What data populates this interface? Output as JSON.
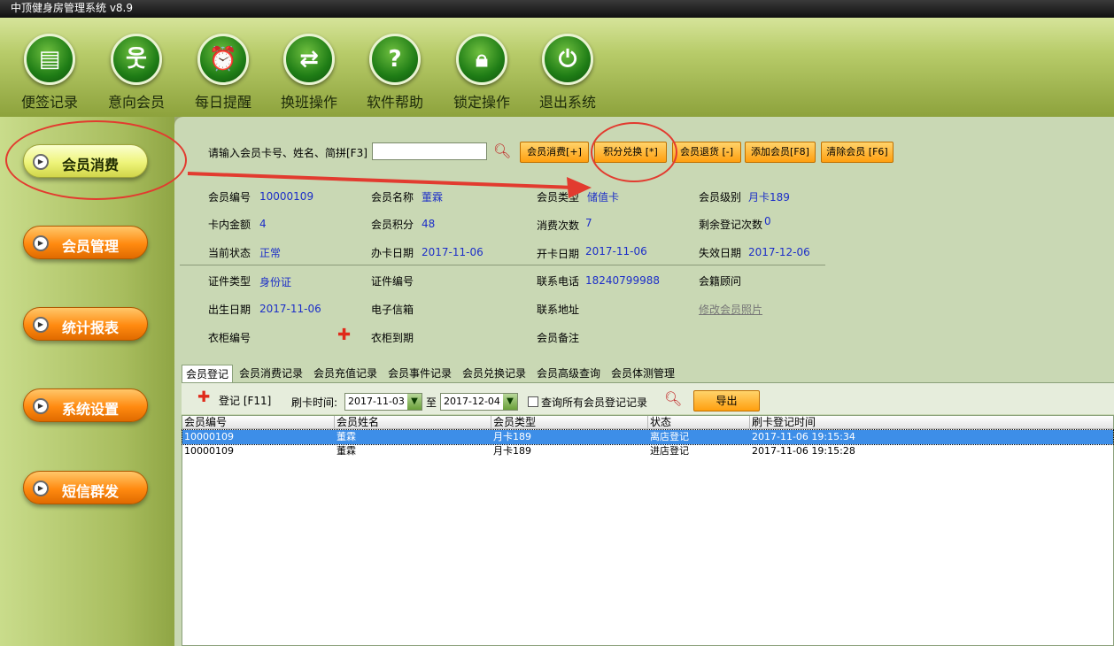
{
  "window": {
    "title": "中顶健身房管理系统 v8.9"
  },
  "toolbar": [
    {
      "label": "便签记录",
      "icon": "document-icon"
    },
    {
      "label": "意向会员",
      "icon": "person-icon"
    },
    {
      "label": "每日提醒",
      "icon": "alarm-clock-icon"
    },
    {
      "label": "换班操作",
      "icon": "swap-arrows-icon"
    },
    {
      "label": "软件帮助",
      "icon": "help-icon"
    },
    {
      "label": "锁定操作",
      "icon": "lock-icon"
    },
    {
      "label": "退出系统",
      "icon": "power-icon"
    }
  ],
  "sidebar": [
    {
      "label": "会员消费"
    },
    {
      "label": "会员管理"
    },
    {
      "label": "统计报表"
    },
    {
      "label": "系统设置"
    },
    {
      "label": "短信群发"
    }
  ],
  "search": {
    "label": "请输入会员卡号、姓名、简拼[F3]",
    "value": ""
  },
  "actions": [
    "会员消费[+]",
    "积分兑换 [*]",
    "会员退货 [-]",
    "添加会员[F8]",
    "清除会员 [F6]"
  ],
  "info": {
    "card_no_label": "会员编号",
    "card_no": "10000109",
    "name_label": "会员名称",
    "name": "董霖",
    "type_label": "会员类型",
    "type": "储值卡",
    "level_label": "会员级别",
    "level": "月卡189",
    "balance_label": "卡内金额",
    "balance": "4",
    "points_label": "会员积分",
    "points": "48",
    "visits_label": "消费次数",
    "visits": "7",
    "remaining_label": "剩余登记次数",
    "remaining": "0",
    "status_label": "当前状态",
    "status": "正常",
    "issue_label": "办卡日期",
    "issue_date": "2017-11-06",
    "open_label": "开卡日期",
    "open_date": "2017-11-06",
    "expire_label": "失效日期",
    "expire_date": "2017-12-06",
    "id_type_label": "证件类型",
    "id_type": "身份证",
    "id_no_label": "证件编号",
    "phone_label": "联系电话",
    "phone": "18240799988",
    "advisor_label": "会籍顾问",
    "birth_label": "出生日期",
    "birth": "2017-11-06",
    "email_label": "电子信箱",
    "address_label": "联系地址",
    "photo_link": "修改会员照片",
    "locker_label": "衣柜编号",
    "locker_expire_label": "衣柜到期",
    "remark_label": "会员备注"
  },
  "tabs": [
    "会员登记",
    "会员消费记录",
    "会员充值记录",
    "会员事件记录",
    "会员兑换记录",
    "会员高级查询",
    "会员体测管理"
  ],
  "register": {
    "add_label": "登记 [F11]",
    "time_label": "刷卡时间:",
    "from": "2017-11-03",
    "to_label": "至",
    "to": "2017-12-04",
    "query_all_label": "查询所有会员登记记录",
    "export_label": "导出"
  },
  "table": {
    "columns": [
      "会员编号",
      "会员姓名",
      "会员类型",
      "状态",
      "刷卡登记时间"
    ],
    "rows": [
      [
        "10000109",
        "董霖",
        "月卡189",
        "离店登记",
        "2017-11-06 19:15:34"
      ],
      [
        "10000109",
        "董霖",
        "月卡189",
        "进店登记",
        "2017-11-06 19:15:28"
      ]
    ]
  },
  "colors": {
    "accent_orange": "#ff9f0f",
    "value_blue": "#1c2ec8",
    "annotation_red": "#e23b2f",
    "selected_row": "#3d8ee8"
  }
}
